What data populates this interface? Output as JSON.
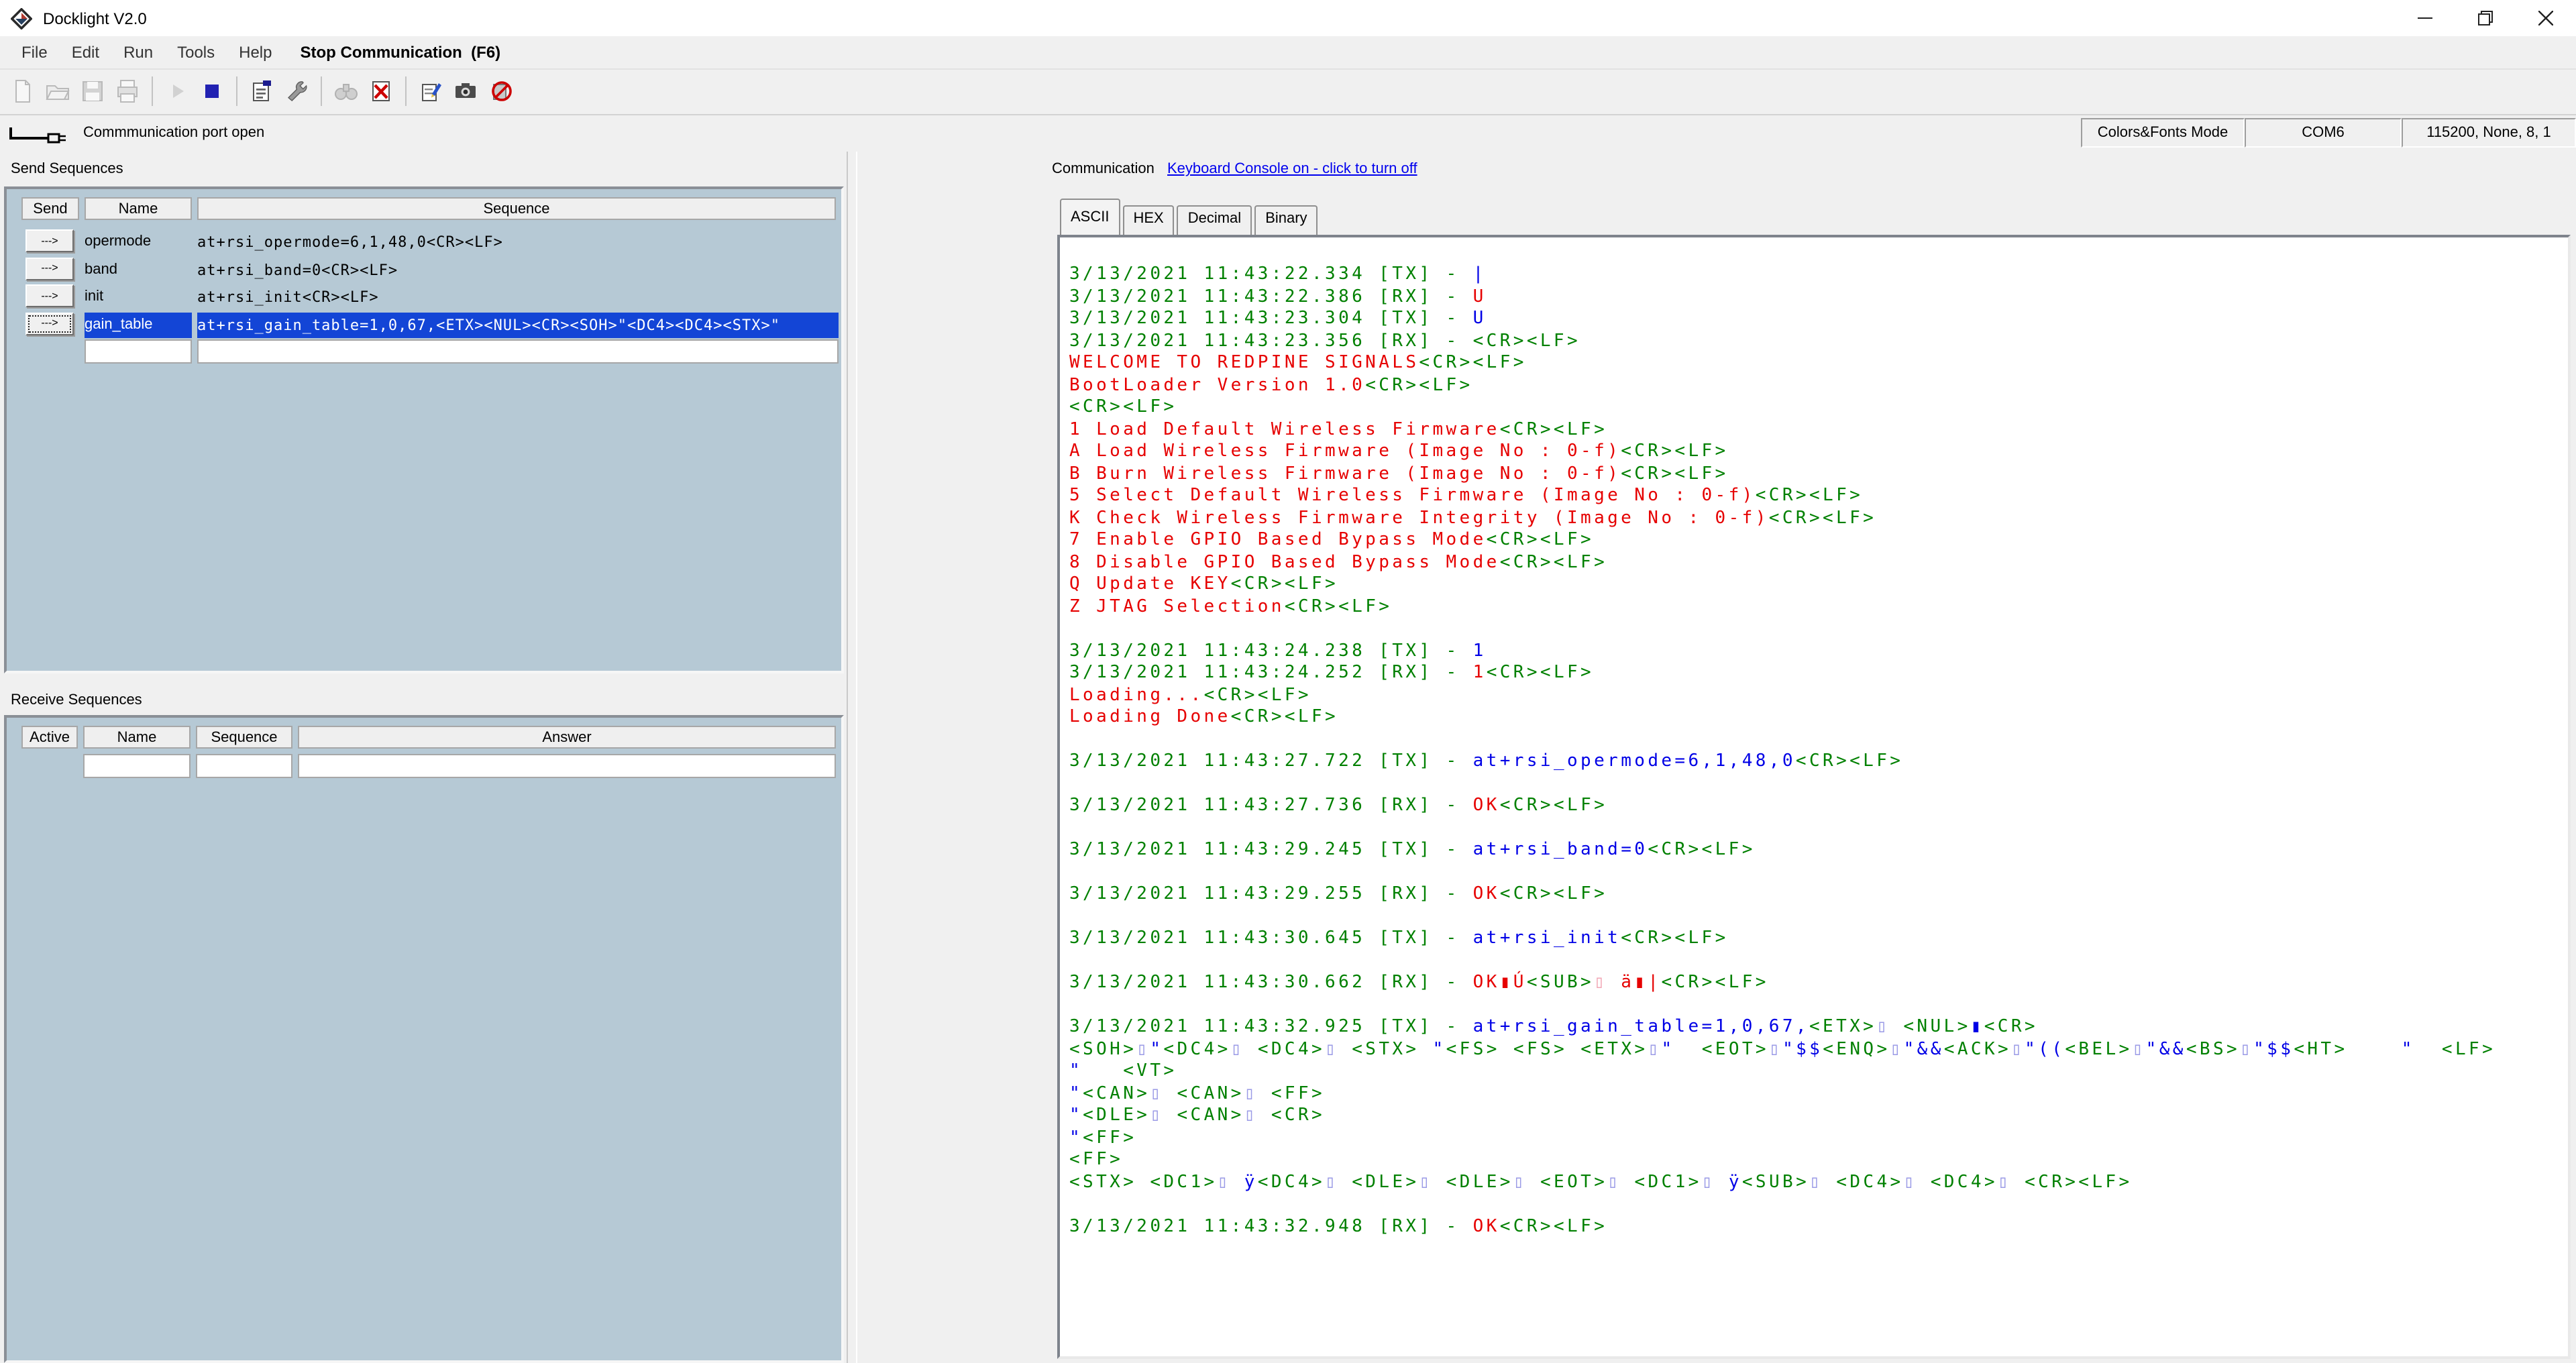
{
  "window": {
    "title": "Docklight V2.0"
  },
  "menu": {
    "items": [
      "File",
      "Edit",
      "Run",
      "Tools",
      "Help"
    ],
    "action": "Stop Communication  (F6)"
  },
  "toolbar": {
    "buttons": [
      {
        "name": "new-file",
        "disabled": true
      },
      {
        "name": "open-project",
        "disabled": true
      },
      {
        "name": "save-project",
        "disabled": true
      },
      {
        "name": "print",
        "disabled": true
      },
      {
        "name": "start-communication",
        "disabled": true
      },
      {
        "name": "stop-communication",
        "disabled": false
      },
      {
        "name": "project-settings",
        "disabled": false
      },
      {
        "name": "options",
        "disabled": false
      },
      {
        "name": "find-sequence",
        "disabled": true
      },
      {
        "name": "clear-communication-window",
        "disabled": false
      },
      {
        "name": "edit-notes",
        "disabled": false
      },
      {
        "name": "snapshot",
        "disabled": false
      },
      {
        "name": "stop-logging",
        "disabled": false
      }
    ]
  },
  "statusbar": {
    "message": "Commmunication port open",
    "mode": "Colors&Fonts Mode",
    "port": "COM6",
    "params": "115200, None, 8, 1"
  },
  "send_sequences": {
    "label": "Send Sequences",
    "columns": [
      "Send",
      "Name",
      "Sequence"
    ],
    "send_button_label": "--->",
    "rows": [
      {
        "name": "opermode",
        "sequence": "at+rsi_opermode=6,1,48,0<CR><LF>",
        "selected": false
      },
      {
        "name": "band",
        "sequence": "at+rsi_band=0<CR><LF>",
        "selected": false
      },
      {
        "name": "init",
        "sequence": "at+rsi_init<CR><LF>",
        "selected": false
      },
      {
        "name": "gain_table",
        "sequence": "at+rsi_gain_table=1,0,67,<ETX><NUL><CR><SOH>\"<DC4><DC4><STX>\"",
        "selected": true
      }
    ]
  },
  "receive_sequences": {
    "label": "Receive Sequences",
    "columns": [
      "Active",
      "Name",
      "Sequence",
      "Answer"
    ]
  },
  "communication": {
    "label": "Communication",
    "keyboard_console_link": "Keyboard Console on - click to turn off",
    "tabs": [
      "ASCII",
      "HEX",
      "Decimal",
      "Binary"
    ],
    "active_tab": "ASCII",
    "colors": {
      "timestamp": "#008000",
      "tx_data": "#0000e6",
      "rx_data": "#e60000",
      "selection": "#1345d6"
    },
    "lines": [
      [
        [
          "g",
          "3/13/2021 11:43:22.334 [TX] - "
        ],
        [
          "b",
          "|"
        ]
      ],
      [
        [
          "g",
          "3/13/2021 11:43:22.386 [RX] - "
        ],
        [
          "r",
          "U"
        ]
      ],
      [
        [
          "g",
          "3/13/2021 11:43:23.304 [TX] - "
        ],
        [
          "b",
          "U"
        ]
      ],
      [
        [
          "g",
          "3/13/2021 11:43:23.356 [RX] - <CR><LF>"
        ]
      ],
      [
        [
          "r",
          "WELCOME TO REDPINE SIGNALS"
        ],
        [
          "g",
          "<CR><LF>"
        ]
      ],
      [
        [
          "r",
          "BootLoader Version 1.0"
        ],
        [
          "g",
          "<CR><LF>"
        ]
      ],
      [
        [
          "g",
          "<CR><LF>"
        ]
      ],
      [
        [
          "r",
          "1 Load Default Wireless Firmware"
        ],
        [
          "g",
          "<CR><LF>"
        ]
      ],
      [
        [
          "r",
          "A Load Wireless Firmware (Image No : 0-f)"
        ],
        [
          "g",
          "<CR><LF>"
        ]
      ],
      [
        [
          "r",
          "B Burn Wireless Firmware (Image No : 0-f)"
        ],
        [
          "g",
          "<CR><LF>"
        ]
      ],
      [
        [
          "r",
          "5 Select Default Wireless Firmware (Image No : 0-f)"
        ],
        [
          "g",
          "<CR><LF>"
        ]
      ],
      [
        [
          "r",
          "K Check Wireless Firmware Integrity (Image No : 0-f)"
        ],
        [
          "g",
          "<CR><LF>"
        ]
      ],
      [
        [
          "r",
          "7 Enable GPIO Based Bypass Mode"
        ],
        [
          "g",
          "<CR><LF>"
        ]
      ],
      [
        [
          "r",
          "8 Disable GPIO Based Bypass Mode"
        ],
        [
          "g",
          "<CR><LF>"
        ]
      ],
      [
        [
          "r",
          "Q Update KEY"
        ],
        [
          "g",
          "<CR><LF>"
        ]
      ],
      [
        [
          "r",
          "Z JTAG Selection"
        ],
        [
          "g",
          "<CR><LF>"
        ]
      ],
      [],
      [
        [
          "g",
          "3/13/2021 11:43:24.238 [TX] - "
        ],
        [
          "b",
          "1"
        ]
      ],
      [
        [
          "g",
          "3/13/2021 11:43:24.252 [RX] - "
        ],
        [
          "r",
          "1"
        ],
        [
          "g",
          "<CR><LF>"
        ]
      ],
      [
        [
          "r",
          "Loading..."
        ],
        [
          "g",
          "<CR><LF>"
        ]
      ],
      [
        [
          "r",
          "Loading Done"
        ],
        [
          "g",
          "<CR><LF>"
        ]
      ],
      [],
      [
        [
          "g",
          "3/13/2021 11:43:27.722 [TX] - "
        ],
        [
          "b",
          "at+rsi_opermode=6,1,48,0"
        ],
        [
          "g",
          "<CR><LF>"
        ]
      ],
      [],
      [
        [
          "g",
          "3/13/2021 11:43:27.736 [RX] - "
        ],
        [
          "r",
          "OK"
        ],
        [
          "g",
          "<CR><LF>"
        ]
      ],
      [],
      [
        [
          "g",
          "3/13/2021 11:43:29.245 [TX] - "
        ],
        [
          "b",
          "at+rsi_band=0"
        ],
        [
          "g",
          "<CR><LF>"
        ]
      ],
      [],
      [
        [
          "g",
          "3/13/2021 11:43:29.255 [RX] - "
        ],
        [
          "r",
          "OK"
        ],
        [
          "g",
          "<CR><LF>"
        ]
      ],
      [],
      [
        [
          "g",
          "3/13/2021 11:43:30.645 [TX] - "
        ],
        [
          "b",
          "at+rsi_init"
        ],
        [
          "g",
          "<CR><LF>"
        ]
      ],
      [],
      [
        [
          "g",
          "3/13/2021 11:43:30.662 [RX] - "
        ],
        [
          "r",
          "OK▮Ú"
        ],
        [
          "g",
          "<SUB>"
        ],
        [
          "pr",
          "▯ "
        ],
        [
          "r",
          "ä▮|"
        ],
        [
          "g",
          "<CR><LF>"
        ]
      ],
      [],
      [
        [
          "g",
          "3/13/2021 11:43:32.925 [TX] - "
        ],
        [
          "b",
          "at+rsi_gain_table=1,0,67,"
        ],
        [
          "g",
          "<ETX>"
        ],
        [
          "pb",
          "▯ "
        ],
        [
          "g",
          "<NUL>"
        ],
        [
          "b",
          "▮"
        ],
        [
          "g",
          "<CR>"
        ]
      ],
      [
        [
          "g",
          "<SOH>"
        ],
        [
          "pb",
          "▯"
        ],
        [
          "b",
          "\""
        ],
        [
          "g",
          "<DC4>"
        ],
        [
          "pb",
          "▯ "
        ],
        [
          "g",
          "<DC4>"
        ],
        [
          "pb",
          "▯ "
        ],
        [
          "g",
          "<STX>"
        ],
        [
          "b",
          " \""
        ],
        [
          "g",
          "<FS>"
        ],
        [
          "b",
          " "
        ],
        [
          "g",
          "<FS>"
        ],
        [
          "b",
          " "
        ],
        [
          "g",
          "<ETX>"
        ],
        [
          "pb",
          "▯"
        ],
        [
          "b",
          "\"  "
        ],
        [
          "g",
          "<EOT>"
        ],
        [
          "pb",
          "▯"
        ],
        [
          "b",
          "\"$$"
        ],
        [
          "g",
          "<ENQ>"
        ],
        [
          "pb",
          "▯"
        ],
        [
          "b",
          "\"&&"
        ],
        [
          "g",
          "<ACK>"
        ],
        [
          "pb",
          "▯"
        ],
        [
          "b",
          "\"(("
        ],
        [
          "g",
          "<BEL>"
        ],
        [
          "pb",
          "▯"
        ],
        [
          "b",
          "\"&&"
        ],
        [
          "g",
          "<BS>"
        ],
        [
          "pb",
          "▯"
        ],
        [
          "b",
          "\"$$"
        ],
        [
          "g",
          "<HT>"
        ],
        [
          "b",
          "    \"  "
        ],
        [
          "g",
          "<LF>"
        ]
      ],
      [
        [
          "b",
          "\"   "
        ],
        [
          "g",
          "<VT>"
        ]
      ],
      [
        [
          "b",
          "\""
        ],
        [
          "g",
          "<CAN>"
        ],
        [
          "pb",
          "▯ "
        ],
        [
          "g",
          "<CAN>"
        ],
        [
          "pb",
          "▯ "
        ],
        [
          "g",
          "<FF>"
        ]
      ],
      [
        [
          "b",
          "\""
        ],
        [
          "g",
          "<DLE>"
        ],
        [
          "pb",
          "▯ "
        ],
        [
          "g",
          "<CAN>"
        ],
        [
          "pb",
          "▯ "
        ],
        [
          "g",
          "<CR>"
        ]
      ],
      [
        [
          "b",
          "\""
        ],
        [
          "g",
          "<FF>"
        ]
      ],
      [
        [
          "g",
          "<FF>"
        ]
      ],
      [
        [
          "g",
          "<STX> <DC1>"
        ],
        [
          "pb",
          "▯ "
        ],
        [
          "b",
          "ÿ"
        ],
        [
          "g",
          "<DC4>"
        ],
        [
          "pb",
          "▯ "
        ],
        [
          "g",
          "<DLE>"
        ],
        [
          "pb",
          "▯ "
        ],
        [
          "g",
          "<DLE>"
        ],
        [
          "pb",
          "▯ "
        ],
        [
          "g",
          "<EOT>"
        ],
        [
          "pb",
          "▯ "
        ],
        [
          "g",
          "<DC1>"
        ],
        [
          "pb",
          "▯ "
        ],
        [
          "b",
          "ÿ"
        ],
        [
          "g",
          "<SUB>"
        ],
        [
          "pb",
          "▯ "
        ],
        [
          "g",
          "<DC4>"
        ],
        [
          "pb",
          "▯ "
        ],
        [
          "g",
          "<DC4>"
        ],
        [
          "pb",
          "▯ "
        ],
        [
          "g",
          "<CR><LF>"
        ]
      ],
      [],
      [
        [
          "g",
          "3/13/2021 11:43:32.948 [RX] - "
        ],
        [
          "r",
          "OK"
        ],
        [
          "g",
          "<CR><LF>"
        ]
      ]
    ]
  }
}
